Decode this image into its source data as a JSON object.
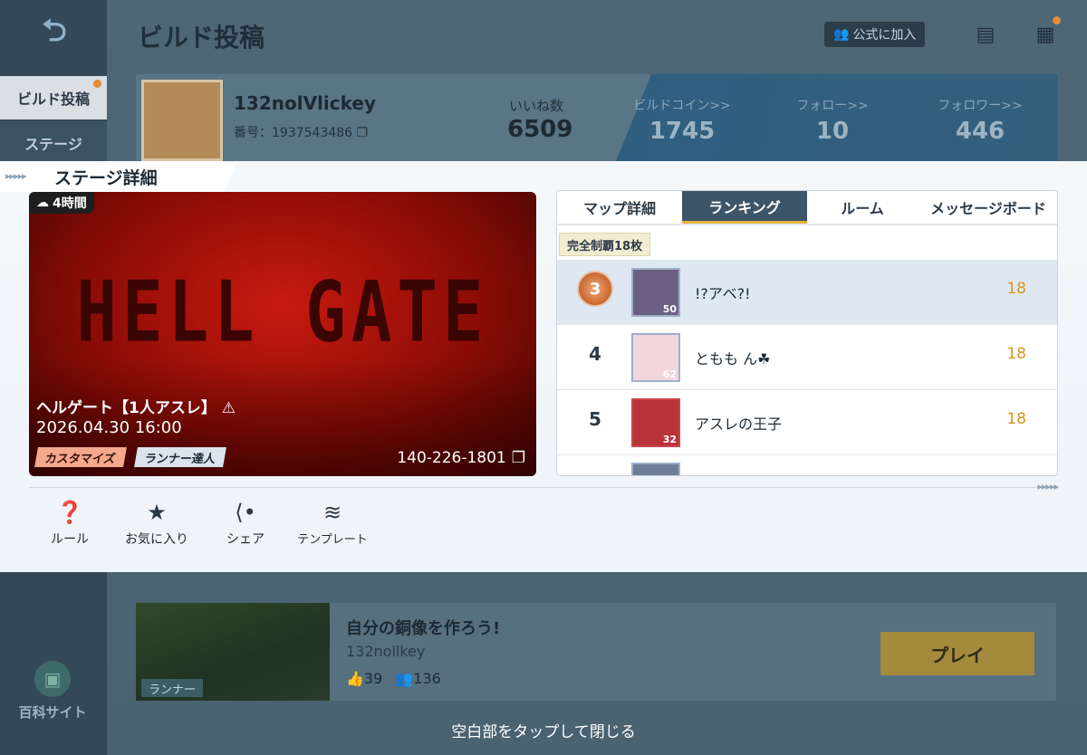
{
  "header": {
    "page_title": "ビルド投稿",
    "join_label": "公式に加入"
  },
  "sidebar": {
    "items": [
      {
        "label": "ビルド投稿"
      },
      {
        "label": "ステージ"
      }
    ],
    "wiki_label": "百科サイト"
  },
  "profile": {
    "username": "132nolVlickey",
    "user_id": "番号：1937543486",
    "likes_label": "いいね数",
    "likes_value": "6509",
    "stats": [
      {
        "label": "ビルドコイン>>",
        "value": "1745"
      },
      {
        "label": "フォロー>>",
        "value": "10"
      },
      {
        "label": "フォロワー>>",
        "value": "446"
      }
    ]
  },
  "modal": {
    "title": "ステージ詳細",
    "arrows": "▸▸▸▸▸",
    "stage": {
      "time_badge": "4時間",
      "art_text": "HELL GATE",
      "name": "ヘルゲート【1人アスレ】 ⚠",
      "date": "2026.04.30 16:00",
      "tags": [
        "カスタマイズ",
        "ランナー達人"
      ],
      "code": "140-226-1801"
    },
    "actions": [
      {
        "label": "ルール",
        "icon": "help-book-icon"
      },
      {
        "label": "お気に入り",
        "icon": "star-icon"
      },
      {
        "label": "シェア",
        "icon": "share-icon"
      },
      {
        "label": "テンプレート",
        "icon": "layers-icon"
      }
    ],
    "tabs": [
      "マップ詳細",
      "ランキング",
      "ルーム",
      "メッセージボード"
    ],
    "active_tab": "ランキング",
    "filter_chip": "完全制覇18枚",
    "ranking": [
      {
        "rank": "3",
        "name": "!?アベ?!",
        "level": "50",
        "score": "18"
      },
      {
        "rank": "4",
        "name": "ともも ん☘",
        "level": "62",
        "score": "18"
      },
      {
        "rank": "5",
        "name": "アスレの王子",
        "level": "32",
        "score": "18"
      }
    ]
  },
  "lower_card": {
    "tag": "ランナー",
    "title": "自分の銅像を作ろう!",
    "user": "132nollkey",
    "likes": "39",
    "followers": "136",
    "play_label": "プレイ"
  },
  "hint": "空白部をタップして閉じる",
  "colors": {
    "accent_gold": "#e3b341",
    "score": "#d9951e",
    "rank_bronze": "#c9662f",
    "modal_bg": "#f4f8fb"
  }
}
